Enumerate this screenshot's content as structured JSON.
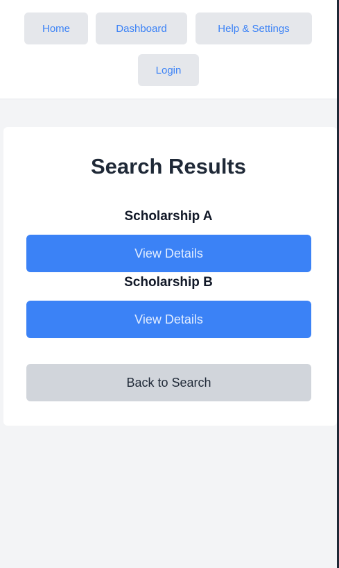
{
  "nav": {
    "home": "Home",
    "dashboard": "Dashboard",
    "help_settings": "Help & Settings",
    "login": "Login"
  },
  "main": {
    "title": "Search Results",
    "results": [
      {
        "name": "Scholarship A",
        "action_label": "View Details"
      },
      {
        "name": "Scholarship B",
        "action_label": "View Details"
      }
    ],
    "back_label": "Back to Search"
  },
  "colors": {
    "primary": "#3b82f6",
    "nav_button_bg": "#e5e7eb",
    "secondary_button_bg": "#d1d5db",
    "page_bg": "#f3f4f6"
  }
}
